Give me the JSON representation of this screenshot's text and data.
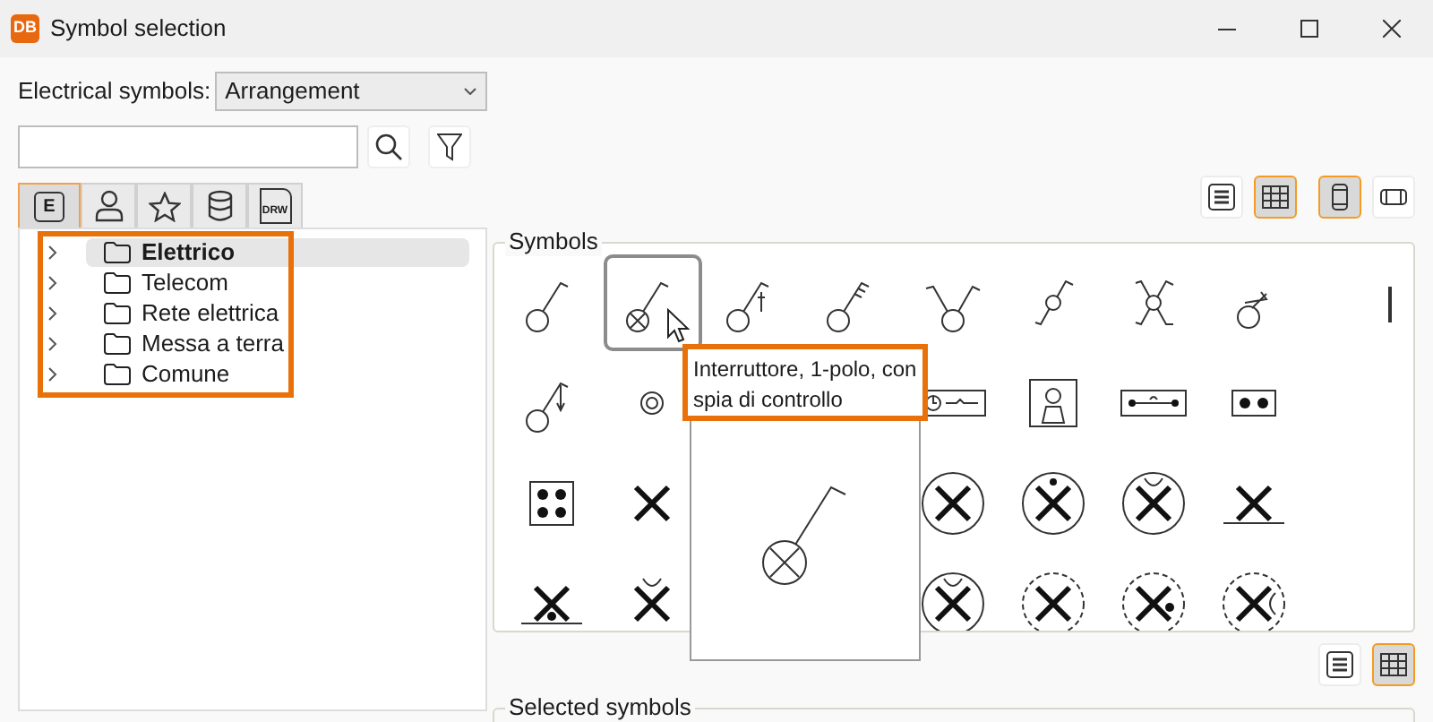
{
  "window": {
    "title": "Symbol selection",
    "app_badge": "DB"
  },
  "symbol_type": {
    "label": "Electrical symbols:",
    "value": "Arrangement"
  },
  "source_tabs": [
    {
      "kind": "electrical",
      "label": "E",
      "selected": true
    },
    {
      "kind": "user",
      "selected": false
    },
    {
      "kind": "favorites",
      "selected": false
    },
    {
      "kind": "database",
      "selected": false
    },
    {
      "kind": "drawing",
      "label": "DRW",
      "selected": false
    }
  ],
  "tree": {
    "highlighted": true,
    "items": [
      {
        "label": "Elettrico",
        "selected": true
      },
      {
        "label": "Telecom",
        "selected": false
      },
      {
        "label": "Rete elettrica",
        "selected": false
      },
      {
        "label": "Messa a terra",
        "selected": false
      },
      {
        "label": "Comune",
        "selected": false
      }
    ]
  },
  "view_toggles": [
    {
      "kind": "list",
      "selected": false
    },
    {
      "kind": "grid",
      "selected": true
    },
    {
      "kind": "portrait",
      "selected": true
    },
    {
      "kind": "landscape",
      "selected": false
    }
  ],
  "symbols": {
    "title": "Symbols",
    "rows": [
      [
        {
          "kind": "switch",
          "selected": false
        },
        {
          "kind": "switch-lamp",
          "selected": true
        },
        {
          "kind": "switch-timer",
          "selected": false
        },
        {
          "kind": "switch-multi",
          "selected": false
        },
        {
          "kind": "switch-double",
          "selected": false
        },
        {
          "kind": "switch-series",
          "selected": false
        },
        {
          "kind": "switch-cross",
          "selected": false
        },
        {
          "kind": "switch-dimmer",
          "selected": false
        }
      ],
      [
        {
          "kind": "switch-pull",
          "selected": false
        },
        {
          "kind": "socket-ring",
          "selected": false
        },
        null,
        null,
        {
          "kind": "clock-box",
          "selected": false
        },
        {
          "kind": "person-box",
          "selected": false
        },
        {
          "kind": "dots-line-box",
          "selected": false
        },
        {
          "kind": "two-dots-box",
          "selected": false
        }
      ],
      [
        {
          "kind": "four-dots-box",
          "selected": false
        },
        {
          "kind": "cross",
          "selected": false
        },
        null,
        null,
        {
          "kind": "cross-circle",
          "selected": false
        },
        {
          "kind": "cross-circle-dot",
          "selected": false
        },
        {
          "kind": "cross-circle-cup",
          "selected": false
        },
        {
          "kind": "cross-ground",
          "selected": false
        }
      ],
      [
        {
          "kind": "cross-ground-dot",
          "selected": false
        },
        {
          "kind": "cross-cup",
          "selected": false
        },
        null,
        null,
        {
          "kind": "cross-circle-cup",
          "selected": false
        },
        {
          "kind": "cross-dashed",
          "selected": false
        },
        {
          "kind": "cross-dashed-dot",
          "selected": false
        },
        {
          "kind": "cross-dashed-arc",
          "selected": false
        }
      ]
    ]
  },
  "tooltip": {
    "text": "Interruttore, 1-polo, con spia di controllo",
    "highlighted": true,
    "preview": {
      "kind": "switch-lamp"
    }
  },
  "bottom_toggles": [
    {
      "kind": "list",
      "selected": false
    },
    {
      "kind": "grid",
      "selected": true
    }
  ],
  "selected_symbols": {
    "title": "Selected symbols"
  }
}
